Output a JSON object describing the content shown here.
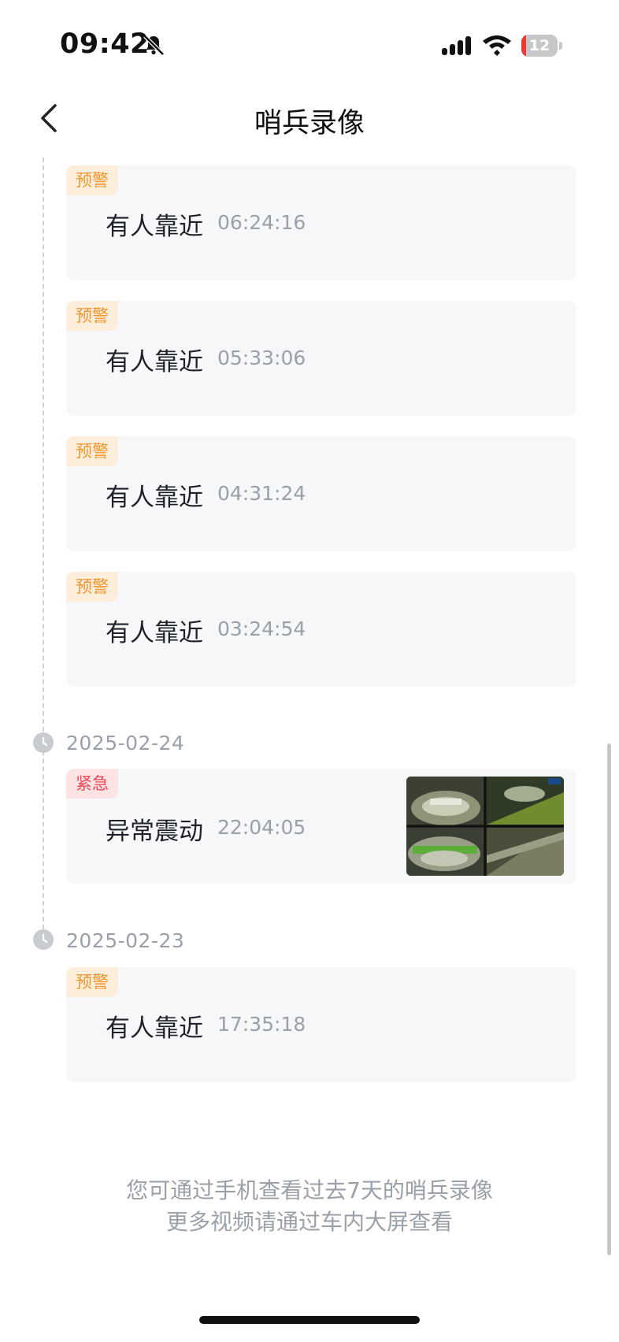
{
  "status_bar": {
    "time": "09:42",
    "battery_level": "12",
    "icons": [
      "bell-slash-icon",
      "signal-icon",
      "wifi-icon",
      "battery-icon"
    ]
  },
  "nav": {
    "title": "哨兵录像",
    "back_icon": "chevron-left-icon"
  },
  "colors": {
    "warn_tag": "#f0972d",
    "urgent_tag": "#ec4a55",
    "card_bg": "#f6f7f9",
    "secondary_text": "#9aa0a8"
  },
  "events_top": [
    {
      "tag": "预警",
      "title": "有人靠近",
      "time": "06:24:16"
    },
    {
      "tag": "预警",
      "title": "有人靠近",
      "time": "05:33:06"
    },
    {
      "tag": "预警",
      "title": "有人靠近",
      "time": "04:31:24"
    },
    {
      "tag": "预警",
      "title": "有人靠近",
      "time": "03:24:54"
    }
  ],
  "groups": [
    {
      "date": "2025-02-24",
      "event": {
        "tag": "紧急",
        "title": "异常震动",
        "time": "22:04:05",
        "has_thumbnail": true
      }
    },
    {
      "date": "2025-02-23",
      "event": {
        "tag": "预警",
        "title": "有人靠近",
        "time": "17:35:18"
      }
    }
  ],
  "footer": {
    "line1": "您可通过手机查看过去7天的哨兵录像",
    "line2": "更多视频请通过车内大屏查看"
  }
}
